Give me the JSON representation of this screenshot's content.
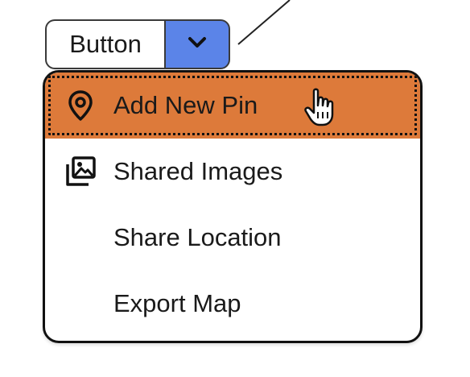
{
  "split_button": {
    "label": "Button",
    "arrow_icon": "chevron-down-icon",
    "arrow_color": "#5b84e8"
  },
  "menu": {
    "highlight_color": "#dd7a3a",
    "items": [
      {
        "label": "Add New Pin",
        "icon": "map-pin-icon",
        "state": "focused"
      },
      {
        "label": "Shared Images",
        "icon": "images-icon",
        "state": "default"
      },
      {
        "label": "Share Location",
        "icon": "",
        "state": "default"
      },
      {
        "label": "Export Map",
        "icon": "",
        "state": "default"
      }
    ]
  },
  "cursor": {
    "icon": "hand-pointer-icon"
  }
}
